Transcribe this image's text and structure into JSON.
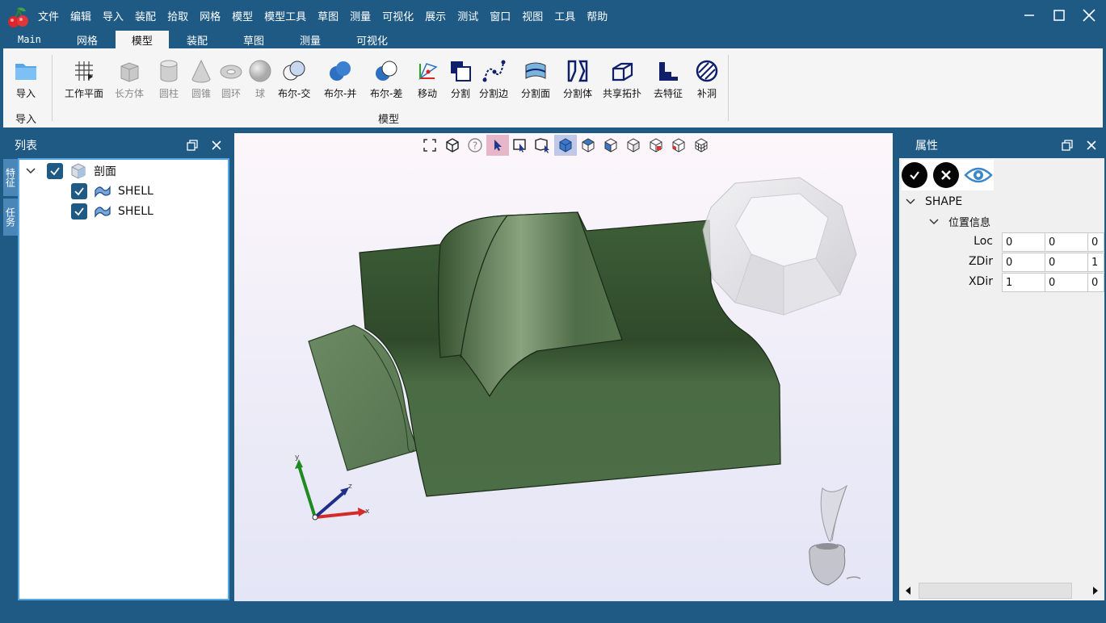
{
  "window": {
    "menu": [
      "文件",
      "编辑",
      "导入",
      "装配",
      "拾取",
      "网格",
      "模型",
      "模型工具",
      "草图",
      "测量",
      "可视化",
      "展示",
      "测试",
      "窗口",
      "视图",
      "工具",
      "帮助"
    ],
    "minimize_icon": "minimize-icon",
    "maximize_icon": "maximize-icon",
    "close_icon": "close-icon"
  },
  "ribbon_tabs": [
    {
      "label": "Main",
      "active": false
    },
    {
      "label": "网格",
      "active": false
    },
    {
      "label": "模型",
      "active": true
    },
    {
      "label": "装配",
      "active": false
    },
    {
      "label": "草图",
      "active": false
    },
    {
      "label": "测量",
      "active": false
    },
    {
      "label": "可视化",
      "active": false
    }
  ],
  "ribbon": {
    "import_group": {
      "button": "导入",
      "label": "导入"
    },
    "model_group": {
      "label": "模型",
      "buttons": [
        "工作平面",
        "长方体",
        "圆柱",
        "圆锥",
        "圆环",
        "球",
        "布尔-交",
        "布尔-并",
        "布尔-差",
        "移动",
        "分割",
        "分割边",
        "分割面",
        "分割体",
        "共享拓扑",
        "去特征",
        "补洞"
      ]
    }
  },
  "left_panel": {
    "title": "列表",
    "side_tabs": [
      "特征",
      "任务"
    ],
    "tree": {
      "root": {
        "label": "剖面",
        "checked": true,
        "expanded": true
      },
      "children": [
        {
          "label": "SHELL",
          "checked": true
        },
        {
          "label": "SHELL",
          "checked": true
        }
      ]
    }
  },
  "properties": {
    "title": "属性",
    "section": "SHAPE",
    "subsection": "位置信息",
    "rows": [
      {
        "label": "Loc",
        "values": [
          "0",
          "0",
          "0"
        ]
      },
      {
        "label": "ZDir",
        "values": [
          "0",
          "0",
          "1"
        ]
      },
      {
        "label": "XDir",
        "values": [
          "1",
          "0",
          "0"
        ]
      }
    ]
  },
  "viewport": {
    "axis": {
      "x": "x",
      "y": "y",
      "z": "z"
    },
    "colors": {
      "surface": "#4a6b45",
      "surface_dark": "#35502f",
      "accent": "#1f5a85"
    }
  }
}
